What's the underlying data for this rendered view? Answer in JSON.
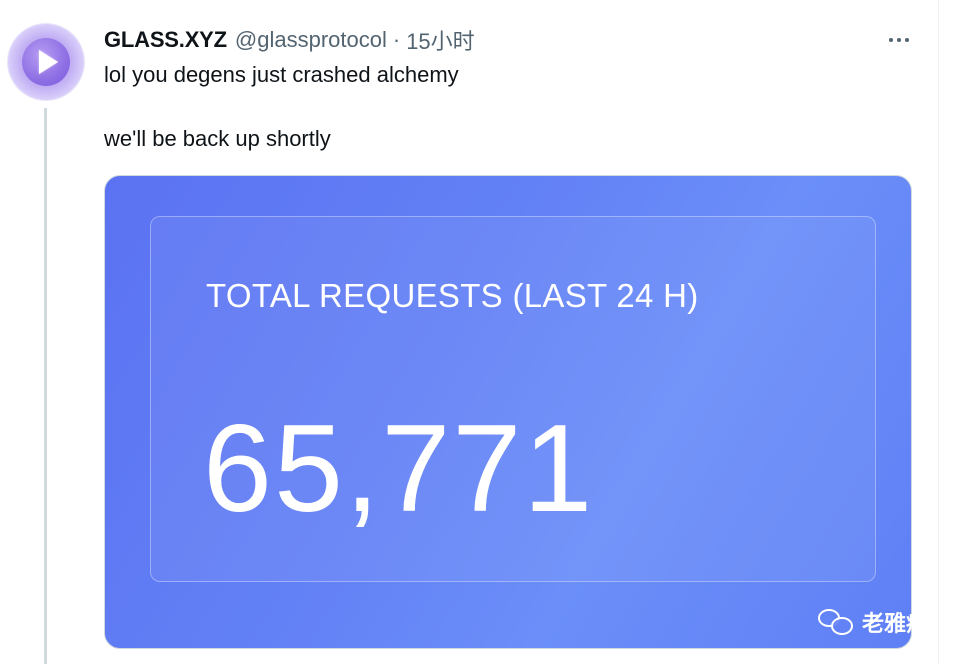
{
  "tweet": {
    "display_name": "GLASS.XYZ",
    "handle": "@glassprotocol",
    "separator": "·",
    "timestamp": "15小时",
    "text_lines": [
      "lol you degens just crashed alchemy",
      "we'll be back up shortly"
    ],
    "more_icon": "more-horizontal-icon"
  },
  "media": {
    "stat_label": "TOTAL REQUESTS (LAST 24 H)",
    "stat_value": "65,771"
  },
  "watermark": {
    "icon": "wechat-icon",
    "text": "老雅痞"
  },
  "colors": {
    "card_gradient_start": "#5b72f2",
    "card_gradient_end": "#6b8ef9",
    "avatar_accent": "#8f6fe4"
  }
}
